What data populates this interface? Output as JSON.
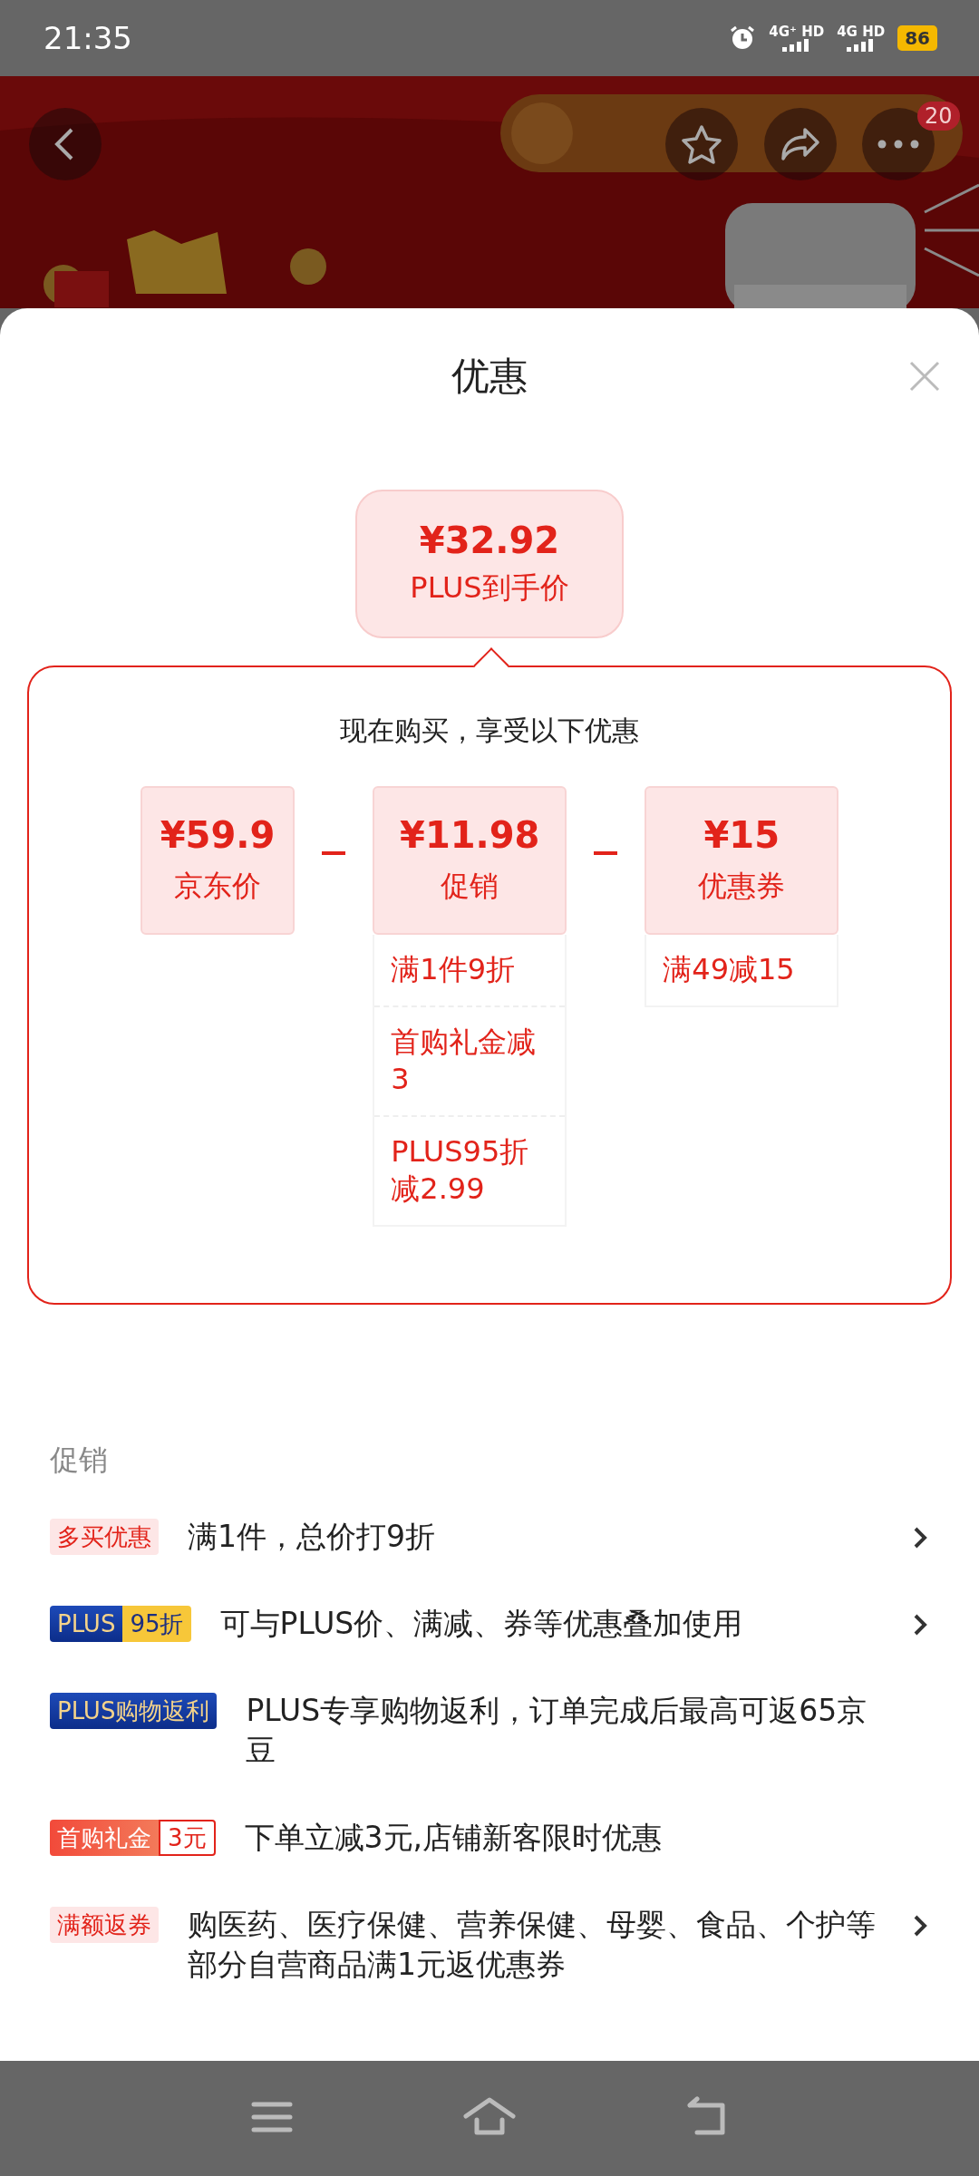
{
  "status_bar": {
    "time": "21:35",
    "networks": [
      "4G⁺ HD",
      "4G HD"
    ],
    "battery": "86"
  },
  "header": {
    "badge": "20"
  },
  "sheet": {
    "title": "优惠",
    "summary": {
      "price": "¥32.92",
      "label": "PLUS到手价"
    },
    "breakdown": {
      "heading": "现在购买，享受以下优惠",
      "items": [
        {
          "amount": "¥59.9",
          "label": "京东价"
        },
        {
          "amount": "¥11.98",
          "label": "促销",
          "details": [
            "满1件9折",
            "首购礼金减3",
            "PLUS95折减2.99"
          ]
        },
        {
          "amount": "¥15",
          "label": "优惠券",
          "details": [
            "满49减15"
          ]
        }
      ]
    },
    "promotions": {
      "heading": "促销",
      "items": [
        {
          "kind": "plain",
          "tag": "多买优惠",
          "text": "满1件，总价打9折",
          "has_arrow": true
        },
        {
          "kind": "plus_split",
          "tag": "PLUS",
          "tag_suffix": "95折",
          "text": "可与PLUS价、满减、券等优惠叠加使用",
          "has_arrow": true
        },
        {
          "kind": "plus",
          "tag": "PLUS购物返利",
          "text": "PLUS专享购物返利，订单完成后最高可返65京豆",
          "has_arrow": false
        },
        {
          "kind": "gift_split",
          "tag": "首购礼金",
          "tag_suffix": "3元",
          "text": "下单立减3元,店铺新客限时优惠",
          "has_arrow": false
        },
        {
          "kind": "plain",
          "tag": "满额返券",
          "text": "购医药、医疗保健、营养保健、母婴、食品、个护等部分自营商品满1元返优惠券",
          "has_arrow": true
        }
      ]
    }
  }
}
